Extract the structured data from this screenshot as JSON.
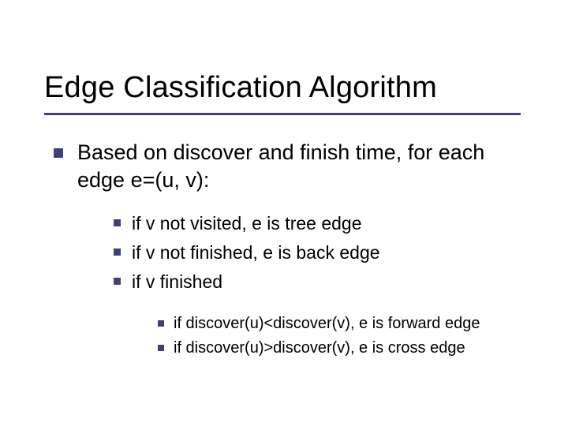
{
  "title": "Edge Classification Algorithm",
  "lvl1": {
    "text": "Based on discover and finish time, for each edge e=(u, v):"
  },
  "lvl2": [
    {
      "text": "if v not visited, e is tree edge"
    },
    {
      "text": "if v not finished, e is back edge"
    },
    {
      "text": "if v finished"
    }
  ],
  "lvl3": [
    {
      "text": "if discover(u)<discover(v), e is forward edge"
    },
    {
      "text": "if discover(u)>discover(v), e is cross edge"
    }
  ]
}
